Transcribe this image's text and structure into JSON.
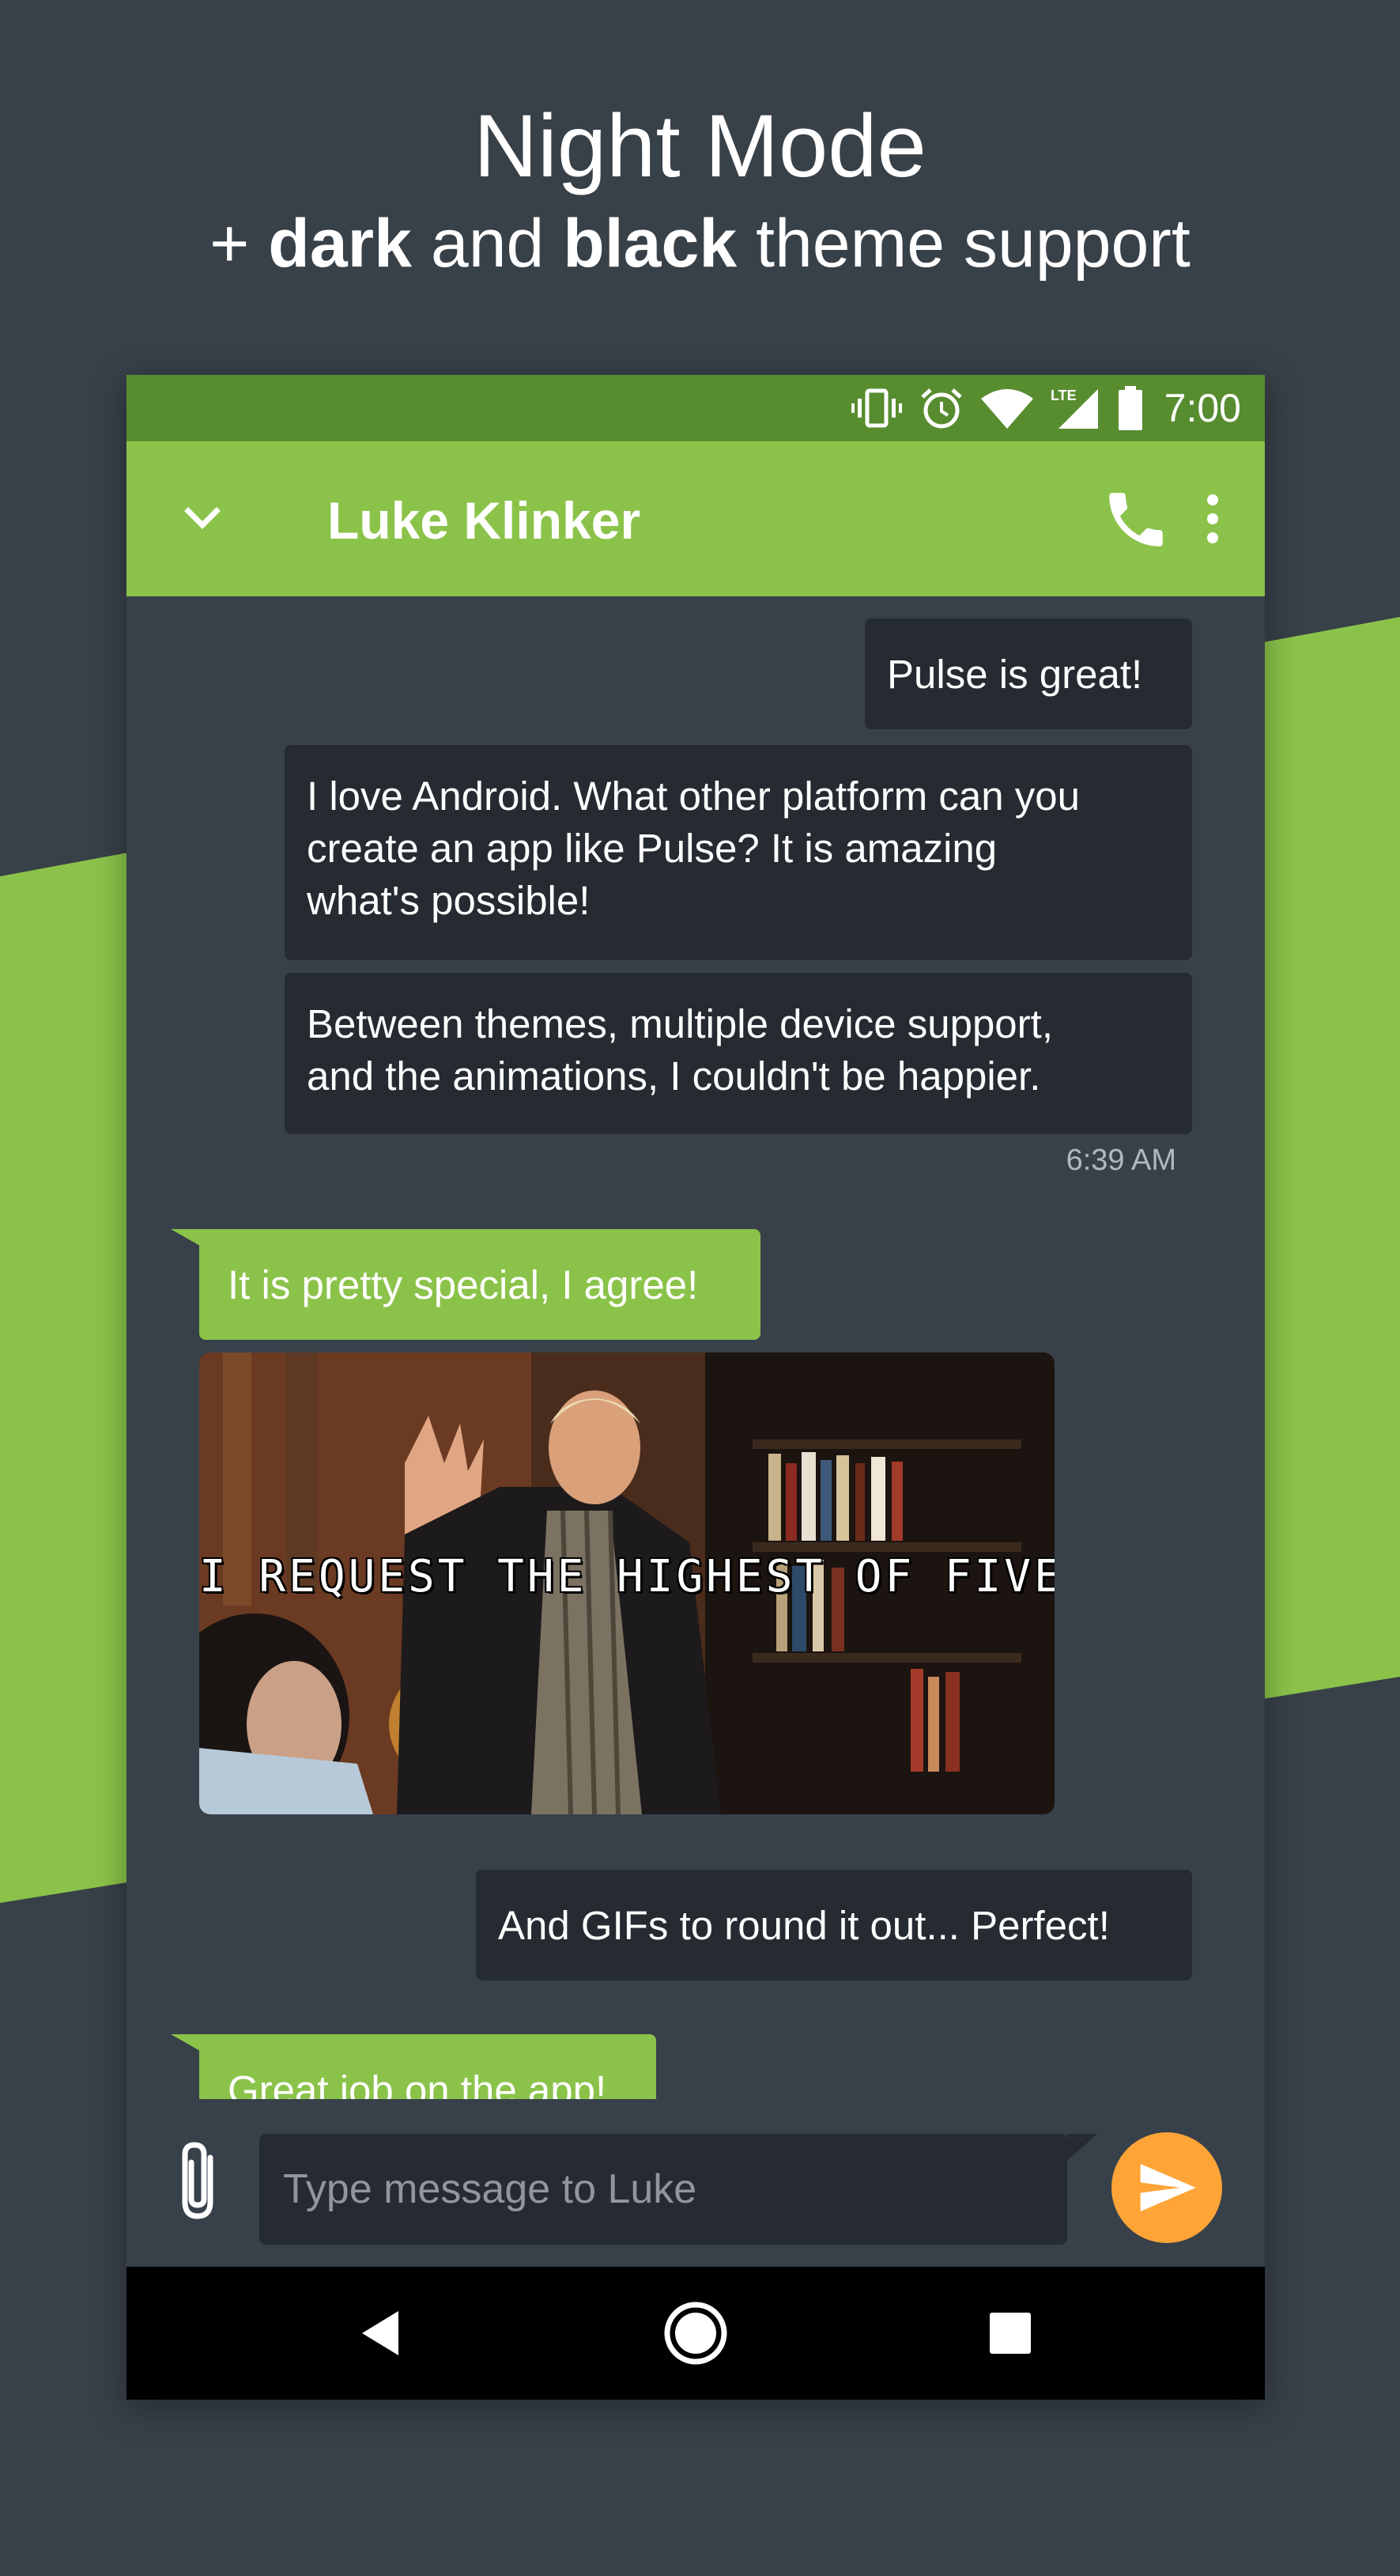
{
  "promo": {
    "title": "Night Mode",
    "subtitle_prefix": "+ ",
    "subtitle_bold_1": "dark",
    "subtitle_mid": " and ",
    "subtitle_bold_2": "black",
    "subtitle_suffix": " theme support"
  },
  "colors": {
    "background": "#384048",
    "accent_green": "#8bc34a",
    "status_green": "#578c2f",
    "send_orange": "#ffa537",
    "sent_bubble": "#252b31"
  },
  "statusbar": {
    "time": "7:00",
    "icons": [
      "vibrate-icon",
      "alarm-icon",
      "wifi-icon",
      "lte-signal-icon",
      "battery-icon"
    ],
    "network_label": "LTE"
  },
  "toolbar": {
    "contact_name": "Luke Klinker",
    "collapse_icon": "chevron-down-icon",
    "call_icon": "phone-icon",
    "more_icon": "more-vert-icon"
  },
  "messages": [
    {
      "direction": "sent",
      "text": "Pulse is great!"
    },
    {
      "direction": "sent",
      "lines": [
        "I love Android. What other platform can you",
        "create an app like Pulse? It is amazing",
        "what's possible!"
      ]
    },
    {
      "direction": "sent",
      "lines": [
        "Between themes, multiple device support,",
        "and the animations, I couldn't be happier."
      ]
    },
    {
      "direction": "sent",
      "timestamp": "6:39 AM"
    },
    {
      "direction": "received",
      "text": "It is pretty special, I agree!"
    },
    {
      "direction": "received",
      "gif_caption": "I REQUEST THE HIGHEST OF FIVES"
    },
    {
      "direction": "sent",
      "text": "And GIFs to round it out... Perfect!"
    },
    {
      "direction": "received",
      "text": "Great job on the app!"
    }
  ],
  "composer": {
    "placeholder": "Type message to Luke",
    "attach_icon": "paperclip-icon",
    "send_icon": "send-icon"
  },
  "navbar": {
    "icons": [
      "back-icon",
      "home-icon",
      "recents-icon"
    ]
  }
}
